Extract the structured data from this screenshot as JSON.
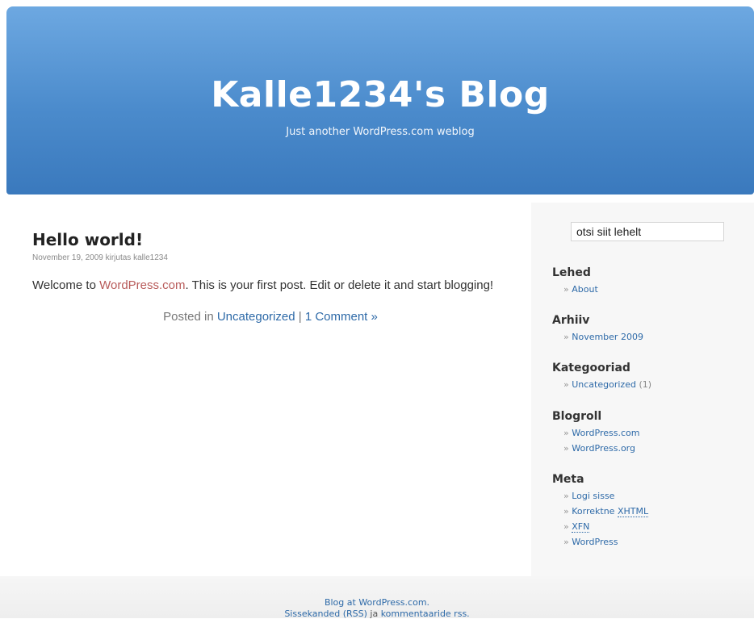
{
  "header": {
    "title": "Kalle1234's Blog",
    "tagline": "Just another WordPress.com weblog"
  },
  "post": {
    "title": "Hello world!",
    "meta": "November 19, 2009 kirjutas kalle1234",
    "body_prefix": "Welcome to ",
    "body_link": "WordPress.com",
    "body_suffix": ". This is your first post. Edit or delete it and start blogging!",
    "posted_in": "Posted in ",
    "category": "Uncategorized",
    "separator": " | ",
    "comments": "1 Comment »"
  },
  "sidebar": {
    "search_value": "otsi siit lehelt",
    "bullet": "»",
    "pages": {
      "heading": "Lehed",
      "items": [
        "About"
      ]
    },
    "archives": {
      "heading": "Arhiiv",
      "items": [
        "November 2009"
      ]
    },
    "categories": {
      "heading": "Kategooriad",
      "items": [
        "Uncategorized"
      ],
      "counts": [
        "(1)"
      ]
    },
    "blogroll": {
      "heading": "Blogroll",
      "items": [
        "WordPress.com",
        "WordPress.org"
      ]
    },
    "meta": {
      "heading": "Meta",
      "login": "Logi sisse",
      "valid_prefix": "Korrektne ",
      "valid_abbr": "XHTML",
      "xfn": "XFN",
      "wordpress": "WordPress"
    }
  },
  "footer": {
    "line1": "Blog at WordPress.com.",
    "line2_a": "Sissekanded (RSS)",
    "line2_mid": " ja ",
    "line2_b": "kommentaaride rss."
  },
  "colors": {
    "header_top": "#6da8e1",
    "header_bottom": "#3a79bd",
    "link": "#2e6aa8",
    "body_link": "#b85b5a",
    "sidebar_bg": "#f7f7f7"
  }
}
